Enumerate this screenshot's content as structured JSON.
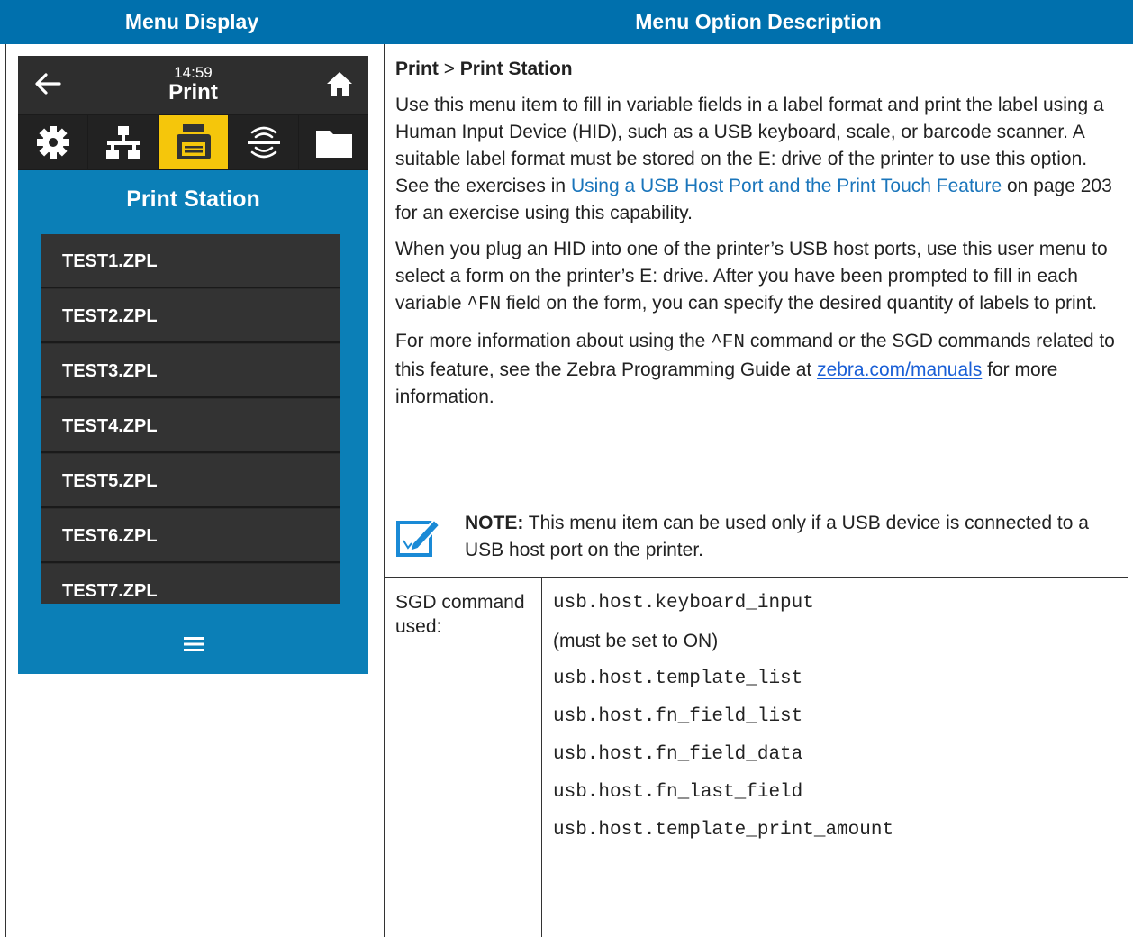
{
  "table_headers": {
    "left": "Menu Display",
    "right": "Menu Option Description"
  },
  "device": {
    "time": "14:59",
    "screen_title": "Print",
    "tabs": [
      {
        "icon": "gear-icon",
        "selected": false
      },
      {
        "icon": "network-icon",
        "selected": false
      },
      {
        "icon": "printer-icon",
        "selected": true
      },
      {
        "icon": "rfid-icon",
        "selected": false
      },
      {
        "icon": "folder-icon",
        "selected": false
      }
    ],
    "section_title": "Print Station",
    "files": [
      "TEST1.ZPL",
      "TEST2.ZPL",
      "TEST3.ZPL",
      "TEST4.ZPL",
      "TEST5.ZPL",
      "TEST6.ZPL",
      "TEST7.ZPL"
    ],
    "colors": {
      "screen_bg": "#0b7fb7",
      "bar_bg": "#2e2e2e",
      "selected_tab": "#f5c60b"
    }
  },
  "description": {
    "crumb_1": "Print",
    "crumb_sep": ">",
    "crumb_2": "Print Station",
    "p1_text": "Use this menu item to fill in variable fields in a label format and print the label using a Human Input Device (HID), such as a USB keyboard, scale, or barcode scanner. A suitable label format must be stored on the E: drive of the printer to use this option. See the exercises in ",
    "p1_link": "Using a USB Host Port and the Print Touch Feature",
    "p1_tail": " on page 203 for an exercise using this capability.",
    "p2_text": "When you plug an HID into one of the printer’s USB host ports, use this user menu to select a form on the printer’s E: drive. After you have been prompted to fill in each variable ",
    "p2_code": "^FN",
    "p2_tail": " field on the form, you can specify the desired quantity of labels to print.",
    "p3_text": "For more information about using the ",
    "p3_code": "^FN",
    "p3_mid": " command or the SGD commands related to this feature, see the Zebra Programming Guide at ",
    "p3_link": "zebra.com/manuals",
    "p3_tail": " for more information.",
    "note_label": "NOTE:",
    "note_text": " This menu item can be used only if a USB device is connected to a USB host port on the printer."
  },
  "sgd": {
    "label": "SGD command used:",
    "items": [
      {
        "text": "usb.host.keyboard_input",
        "code": true
      },
      {
        "text": "(must be set to ON)",
        "code": false
      },
      {
        "text": "usb.host.template_list",
        "code": true
      },
      {
        "text": "usb.host.fn_field_list",
        "code": true
      },
      {
        "text": "usb.host.fn_field_data",
        "code": true
      },
      {
        "text": "usb.host.fn_last_field",
        "code": true
      },
      {
        "text": "usb.host.template_print_amount",
        "code": true
      }
    ]
  }
}
